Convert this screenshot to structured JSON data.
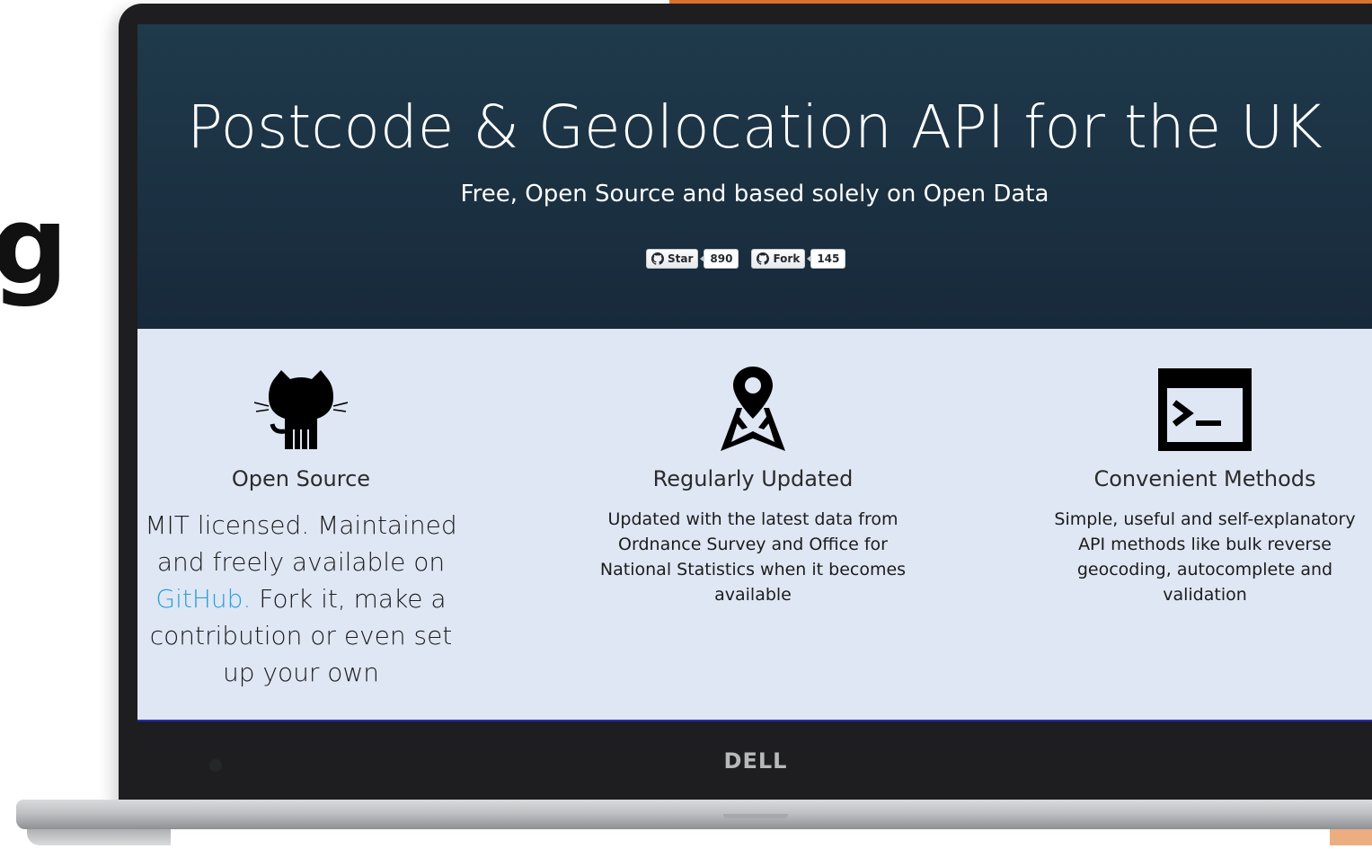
{
  "left_edge": {
    "partial_glyph": "g"
  },
  "hero": {
    "title": "Postcode & Geolocation API for the UK",
    "subtitle": "Free, Open Source and based solely on Open Data",
    "star_button": {
      "label": "Star",
      "count": "890"
    },
    "fork_button": {
      "label": "Fork",
      "count": "145"
    }
  },
  "features": [
    {
      "icon": "github-octocat-icon",
      "title": "Open Source",
      "text_before_link": "MIT licensed. Maintained and freely available on ",
      "link_text": "GitHub.",
      "text_after_link": " Fork it, make a contribution or even set up your own"
    },
    {
      "icon": "map-pin-icon",
      "title": "Regularly Updated",
      "text": "Updated with the latest data from Ordnance Survey and Office for National Statistics when it becomes available"
    },
    {
      "icon": "terminal-icon",
      "title": "Convenient Methods",
      "text": "Simple, useful and self-explanatory API methods like bulk reverse geocoding, autocomplete and validation"
    }
  ],
  "laptop": {
    "brand": "DELL"
  },
  "colors": {
    "hero_background": "#1b3142",
    "features_background": "#dfe7f5",
    "link": "#2a9fd6",
    "accent_orange": "#e0762d"
  }
}
